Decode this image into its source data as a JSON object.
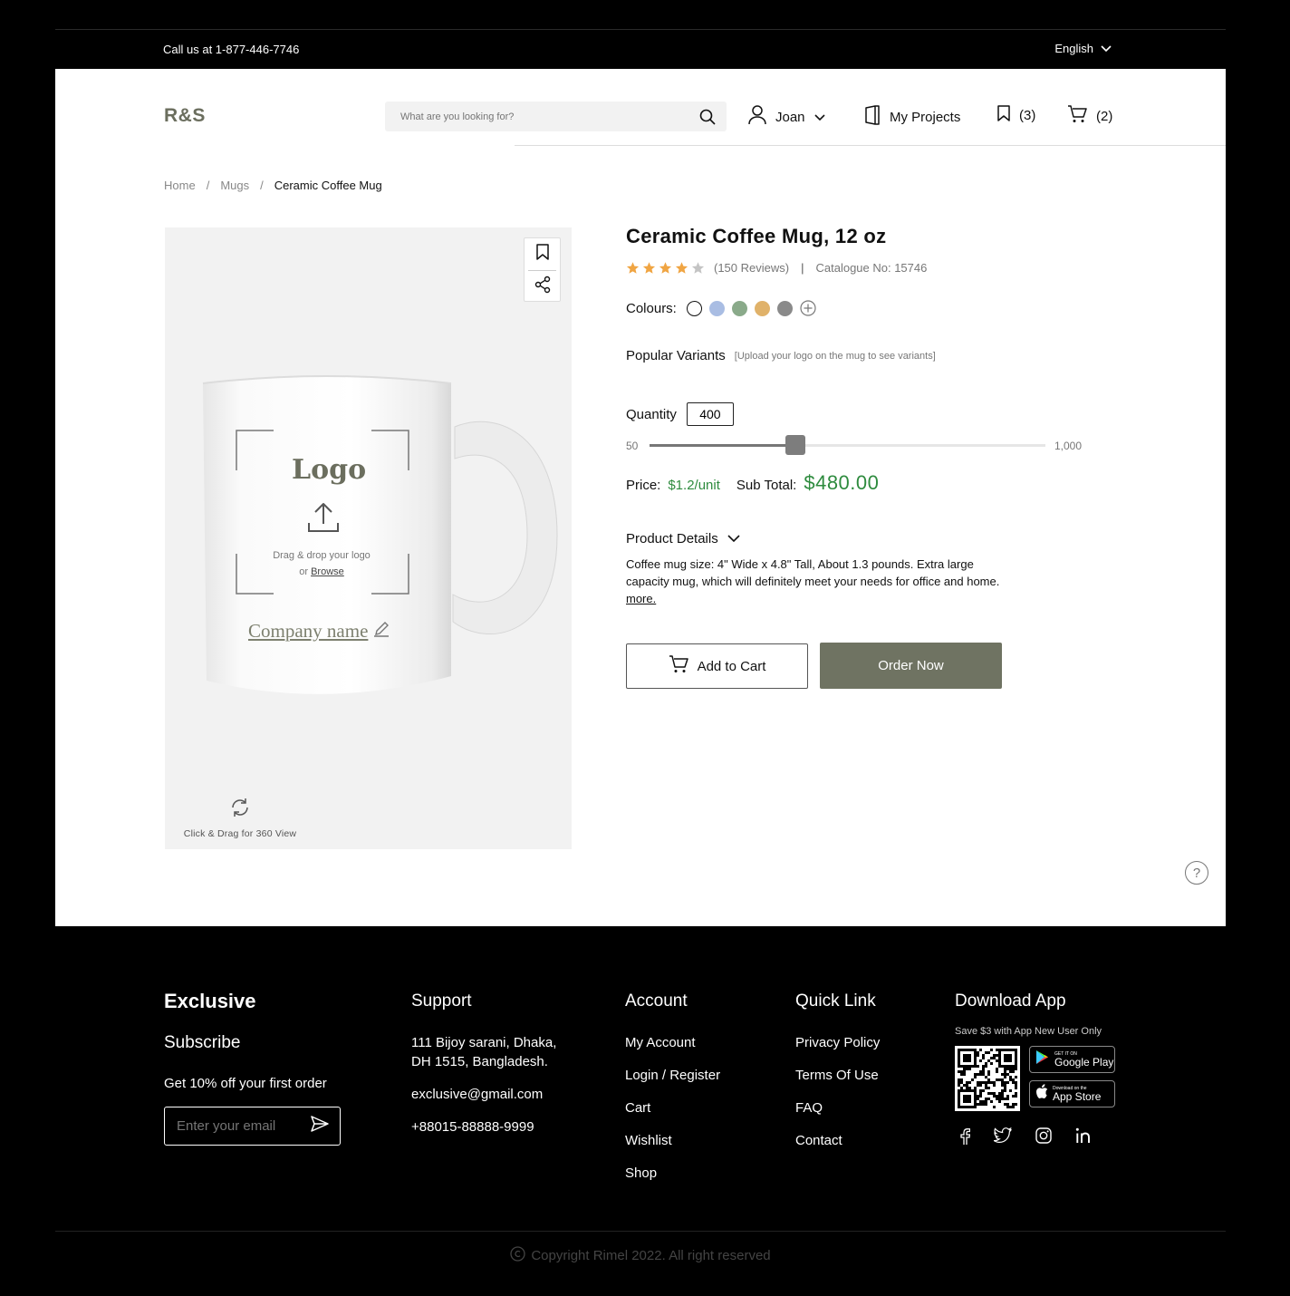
{
  "topbar": {
    "call": "Call us at 1-877-446-7746",
    "language": "English"
  },
  "header": {
    "logo": "R&S",
    "search_placeholder": "What are you looking for?",
    "user": "Joan",
    "projects": "My Projects",
    "saved_count": "(3)",
    "cart_count": "(2)"
  },
  "breadcrumb": {
    "home": "Home",
    "sep": "/",
    "category": "Mugs",
    "current": "Ceramic Coffee Mug"
  },
  "editor": {
    "logo_placeholder": "Logo",
    "drag_text": "Drag & drop your logo",
    "or": "or",
    "browse": "Browse",
    "company_name": "Company name",
    "view360": "Click & Drag for 360 View"
  },
  "product": {
    "title": "Ceramic Coffee Mug, 12 oz",
    "rating": 4,
    "reviews": "(150 Reviews)",
    "catalogue": "Catalogue No: 15746",
    "colours_label": "Colours:",
    "colours": [
      "#ffffff",
      "#a9bde3",
      "#8aaa8a",
      "#e0b26a",
      "#8a8a8a"
    ],
    "variants_label": "Popular Variants",
    "variants_hint": "[Upload your logo on the mug to see variants]",
    "quantity_label": "Quantity",
    "quantity": "400",
    "qty_min_label": "50",
    "qty_max_label": "1,000",
    "qty_min": 50,
    "qty_max": 1000,
    "qty_value": 400,
    "price_label": "Price:",
    "price": "$1.2/unit",
    "subtotal_label": "Sub Total:",
    "subtotal": "$480.00",
    "details_label": "Product Details",
    "details_text": "Coffee mug size: 4\" Wide x 4.8\" Tall, About 1.3 pounds. Extra large capacity mug, which will definitely meet your needs for office and home.",
    "more": "more.",
    "add_to_cart": "Add to Cart",
    "order_now": "Order Now"
  },
  "footer": {
    "brand": "Exclusive",
    "subscribe": "Subscribe",
    "offer": "Get 10% off your first order",
    "email_placeholder": "Enter your email",
    "support_title": "Support",
    "address": "111 Bijoy sarani, Dhaka,\nDH 1515, Bangladesh.",
    "email": "exclusive@gmail.com",
    "phone": "+88015-88888-9999",
    "account_title": "Account",
    "account_links": [
      "My Account",
      "Login / Register",
      "Cart",
      "Wishlist",
      "Shop"
    ],
    "quick_title": "Quick Link",
    "quick_links": [
      "Privacy Policy",
      "Terms Of Use",
      "FAQ",
      "Contact"
    ],
    "app_title": "Download App",
    "app_note": "Save $3 with App New User Only",
    "google_small": "GET IT ON",
    "google_large": "Google Play",
    "apple_small": "Download on the",
    "apple_large": "App Store",
    "copyright": "Copyright Rimel 2022. All right reserved"
  }
}
